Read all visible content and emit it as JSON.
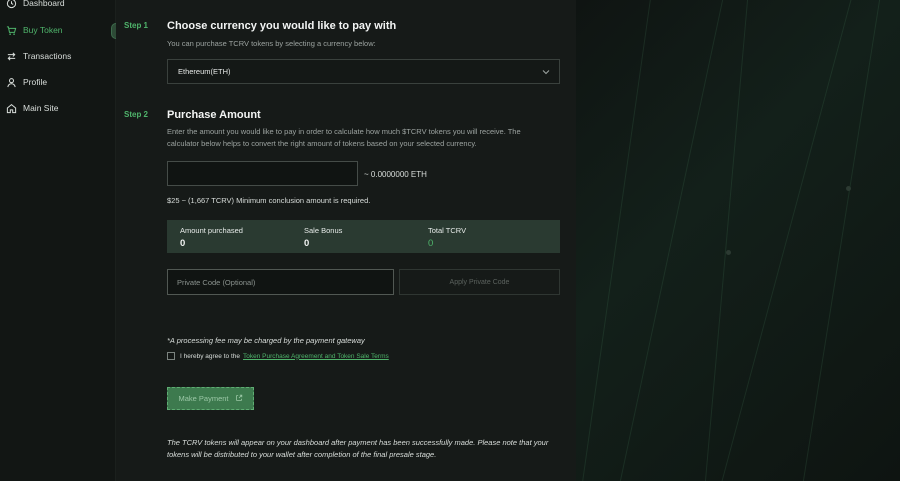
{
  "sidebar": {
    "items": [
      {
        "label": "Dashboard",
        "icon": "clock-icon"
      },
      {
        "label": "Buy Token",
        "icon": "cart-icon",
        "active": true
      },
      {
        "label": "Transactions",
        "icon": "swap-icon"
      },
      {
        "label": "Profile",
        "icon": "user-icon"
      },
      {
        "label": "Main Site",
        "icon": "home-icon"
      }
    ]
  },
  "step1": {
    "step": "Step 1",
    "title": "Choose currency you would like to pay with",
    "description": "You can purchase TCRV tokens by selecting a currency below:",
    "currency_selected": "Ethereum(ETH)"
  },
  "step2": {
    "step": "Step 2",
    "title": "Purchase Amount",
    "description": "Enter the amount you would like to pay in order to calculate how much $TCRV tokens you will receive. The calculator below helps to convert the right amount of tokens based on your selected currency.",
    "amount_value": "",
    "conversion": "~ 0.0000000 ETH",
    "minimum_note": "$25 ~ (1,667 TCRV) Minimum conclusion amount is required."
  },
  "summary": {
    "amount_purchased_label": "Amount purchased",
    "amount_purchased_value": "0",
    "sale_bonus_label": "Sale Bonus",
    "sale_bonus_value": "0",
    "total_label": "Total TCRV",
    "total_value": "0"
  },
  "private_code": {
    "placeholder": "Private Code (Optional)",
    "apply_label": "Apply Private Code"
  },
  "fee_note": "*A processing fee may be charged by the payment gateway",
  "agreement": {
    "prefix": "I hereby agree to the",
    "link": "Token Purchase Agreement and Token Sale Terms"
  },
  "pay_button": "Make Payment",
  "footer_note": "The TCRV tokens will appear on your dashboard after payment has been successfully made. Please note that your tokens will be distributed to your wallet after completion of the final presale stage.",
  "colors": {
    "accent": "#4fb46b",
    "summary_bg": "#2a3a31",
    "panel_bg": "#161a18"
  }
}
